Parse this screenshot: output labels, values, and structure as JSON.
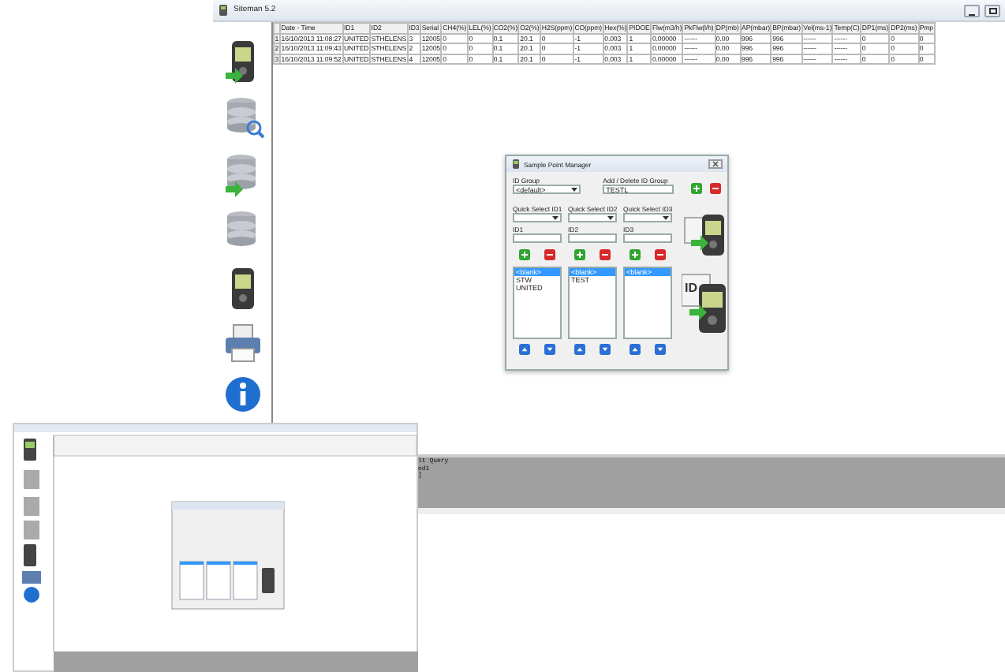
{
  "main_window": {
    "title": "Siteman 5.2"
  },
  "table": {
    "columns": [
      "Date - Time",
      "ID1",
      "ID2",
      "ID3",
      "Serial",
      "CH4(%)",
      "LEL(%)",
      "CO2(%)",
      "O2(%)",
      "H2S(ppm)",
      "CO(ppm)",
      "Hex(%)",
      "PIDOE",
      "Flw(m3/h)",
      "PkFlw(l/h)",
      "DP(mb)",
      "AP(mbar)",
      "BP(mbar)",
      "Vel(ms-1)",
      "Temp(C)",
      "DP1(ms)",
      "DP2(ms)",
      "Pmp"
    ],
    "rows": [
      {
        "number": "1",
        "cells": [
          "16/10/2013 11:08:27",
          "UNITED",
          "STHELENS",
          "3",
          "12005",
          "0",
          "0",
          "0.1",
          "20.1",
          "0",
          "-1",
          "0.003",
          "1",
          "0.00000",
          "------",
          "0.00",
          "996",
          "996",
          "------",
          "------",
          "0",
          "0",
          "0"
        ]
      },
      {
        "number": "2",
        "cells": [
          "16/10/2013 11:09:43",
          "UNITED",
          "STHELENS",
          "2",
          "12005",
          "0",
          "0",
          "0.1",
          "20.1",
          "0",
          "-1",
          "0.003",
          "1",
          "0.00000",
          "------",
          "0.00",
          "996",
          "996",
          "------",
          "------",
          "0",
          "0",
          "0"
        ]
      },
      {
        "number": "3",
        "cells": [
          "16/10/2013 11:09:52",
          "UNITED",
          "STHELENS",
          "4",
          "12005",
          "0",
          "0",
          "0.1",
          "20.1",
          "0",
          "-1",
          "0.003",
          "1",
          "0.00000",
          "------",
          "0.00",
          "996",
          "996",
          "------",
          "------",
          "0",
          "0",
          "0"
        ]
      }
    ]
  },
  "dialog": {
    "title": "Sample Point Manager",
    "id_group": {
      "label": "ID Group",
      "value": "<default>"
    },
    "add_delete": {
      "label": "Add / Delete ID Group",
      "value": "TESTL"
    },
    "badge_text": "ID",
    "id_columns": [
      {
        "quick_select_label": "Quick Select ID1",
        "id_label": "ID1",
        "items": [
          {
            "text": "<blank>",
            "selected": true
          },
          {
            "text": "STW",
            "selected": false
          },
          {
            "text": "UNITED",
            "selected": false
          }
        ]
      },
      {
        "quick_select_label": "Quick Select ID2",
        "id_label": "ID2",
        "items": [
          {
            "text": "<blank>",
            "selected": true
          },
          {
            "text": "TEST",
            "selected": false
          }
        ]
      },
      {
        "quick_select_label": "Quick Select ID3",
        "id_label": "ID3",
        "items": [
          {
            "text": "<blank>",
            "selected": true
          }
        ]
      }
    ]
  },
  "log_panel": {
    "lines": [
      "lt Query",
      "ed1",
      "]"
    ]
  }
}
